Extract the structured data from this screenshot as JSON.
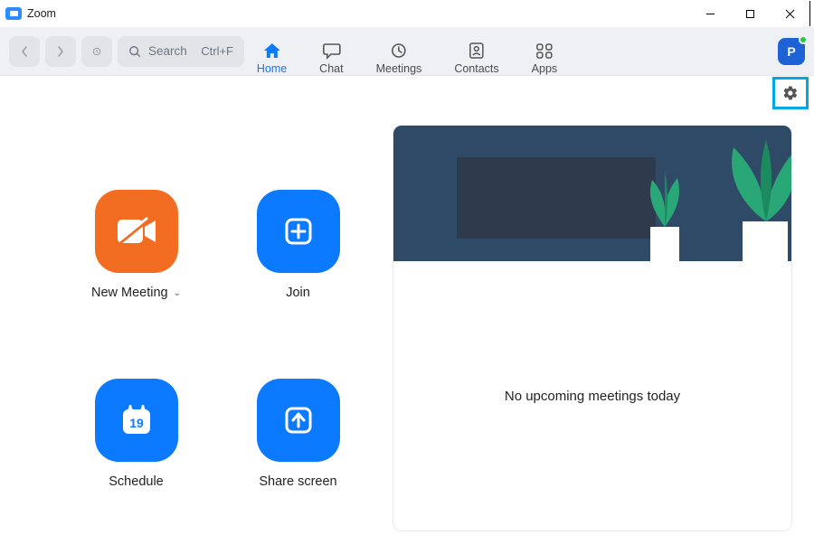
{
  "window": {
    "title": "Zoom"
  },
  "toolbar": {
    "search_placeholder": "Search",
    "search_hotkey": "Ctrl+F",
    "tabs": [
      {
        "label": "Home"
      },
      {
        "label": "Chat"
      },
      {
        "label": "Meetings"
      },
      {
        "label": "Contacts"
      },
      {
        "label": "Apps"
      }
    ],
    "active_tab": "Home",
    "avatar_initial": "P"
  },
  "actions": {
    "new_meeting": "New Meeting",
    "join": "Join",
    "schedule": "Schedule",
    "schedule_day": "19",
    "share_screen": "Share screen"
  },
  "info": {
    "empty_state": "No upcoming meetings today"
  },
  "colors": {
    "accent": "#0b7aff",
    "orange": "#f26d21",
    "settings_highlight": "#00a7e1"
  }
}
